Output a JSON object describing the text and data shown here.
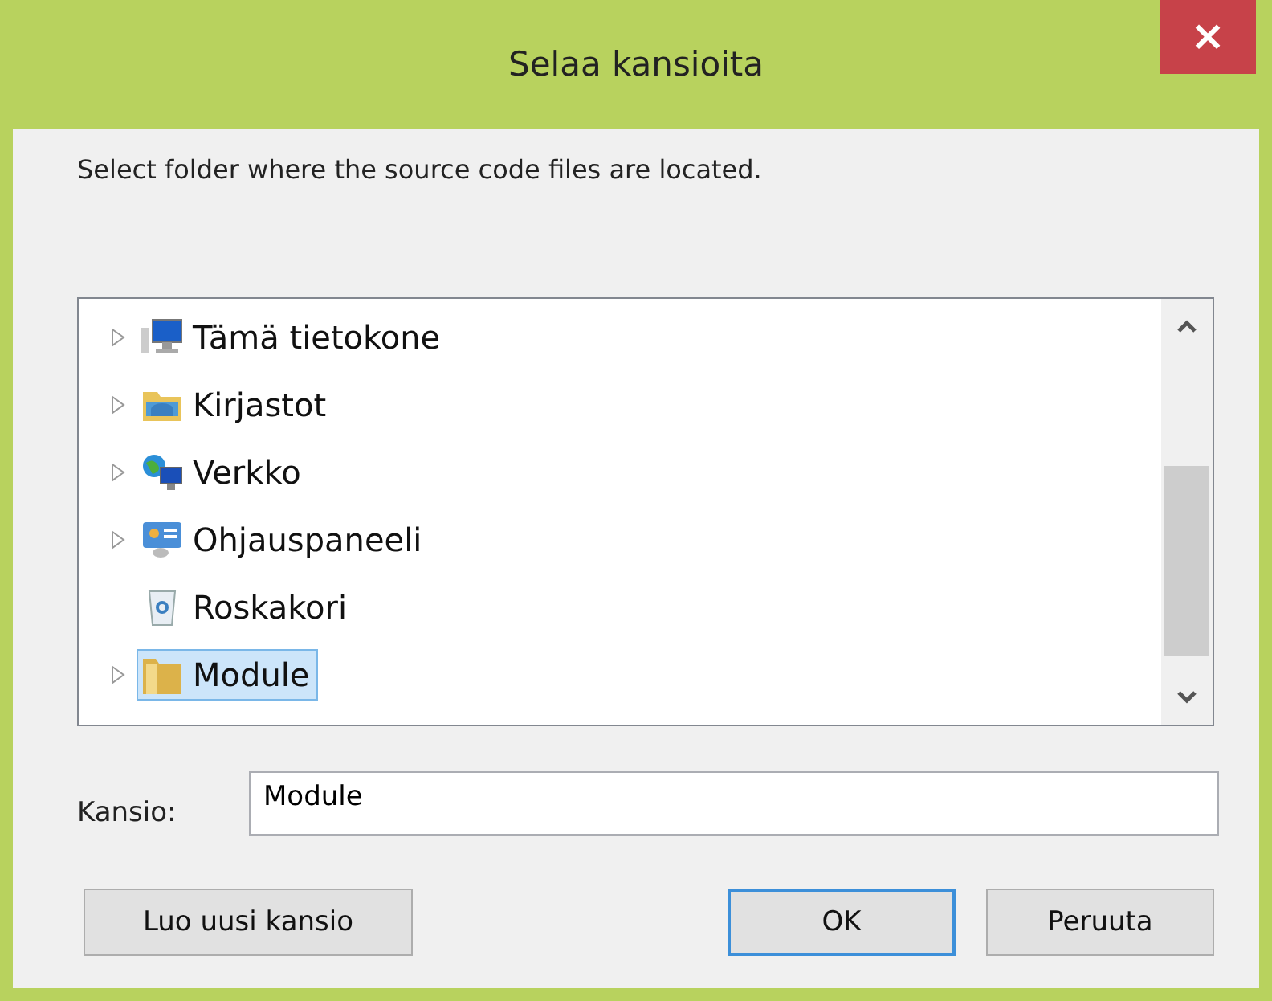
{
  "window": {
    "title": "Selaa kansioita",
    "close": "×"
  },
  "instruction": "Select folder where the source code files are located.",
  "tree": {
    "items": [
      {
        "label": "Tämä tietokone",
        "kind": "computer",
        "has_children": true,
        "selected": false
      },
      {
        "label": "Kirjastot",
        "kind": "library",
        "has_children": true,
        "selected": false
      },
      {
        "label": "Verkko",
        "kind": "network",
        "has_children": true,
        "selected": false
      },
      {
        "label": "Ohjauspaneeli",
        "kind": "control-panel",
        "has_children": true,
        "selected": false
      },
      {
        "label": "Roskakori",
        "kind": "recycle-bin",
        "has_children": false,
        "selected": false
      },
      {
        "label": "Module",
        "kind": "folder",
        "has_children": true,
        "selected": true
      }
    ]
  },
  "folder_field": {
    "label": "Kansio:",
    "value": "Module"
  },
  "buttons": [
    {
      "label": "Luo uusi kansio",
      "kind": "left",
      "default": false
    },
    {
      "label": "OK",
      "kind": "right",
      "default": true
    },
    {
      "label": "Peruuta",
      "kind": "right",
      "default": false
    }
  ]
}
